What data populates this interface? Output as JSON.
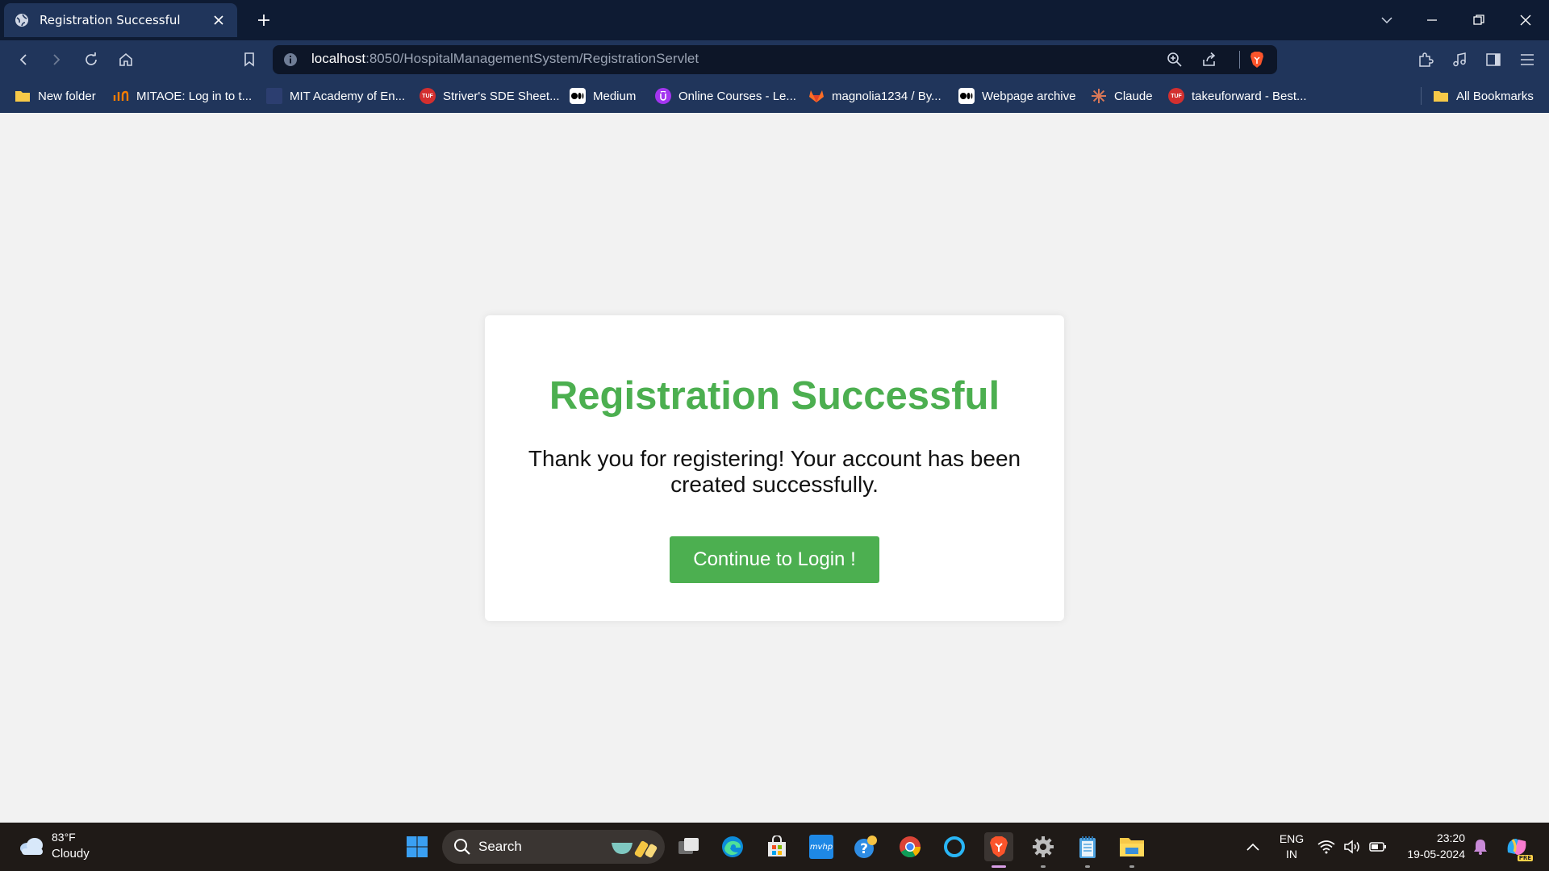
{
  "browser": {
    "tab_title": "Registration Successful",
    "url_host": "localhost",
    "url_rest": ":8050/HospitalManagementSystem/RegistrationServlet",
    "bookmarks": [
      {
        "label": "New folder",
        "icon": "folder-icon"
      },
      {
        "label": "MITAOE: Log in to t...",
        "icon": "mitaoe-icon"
      },
      {
        "label": "MIT Academy of En...",
        "icon": "mit-icon"
      },
      {
        "label": "Striver's SDE Sheet...",
        "icon": "tuf-icon"
      },
      {
        "label": "Medium",
        "icon": "medium-icon"
      },
      {
        "label": "Online Courses - Le...",
        "icon": "udemy-icon"
      },
      {
        "label": "magnolia1234 / By...",
        "icon": "gitlab-icon"
      },
      {
        "label": "Webpage archive",
        "icon": "archive-icon"
      },
      {
        "label": "Claude",
        "icon": "claude-icon"
      },
      {
        "label": "takeuforward - Best...",
        "icon": "tuf-icon"
      }
    ],
    "all_bookmarks": "All Bookmarks",
    "tuf_badge": "TUF"
  },
  "page": {
    "heading": "Registration Successful",
    "message": "Thank you for registering! Your account has been created successfully.",
    "button_label": "Continue to Login !"
  },
  "taskbar": {
    "temp": "83°F",
    "condition": "Cloudy",
    "search_label": "Search",
    "language": "ENG",
    "region": "IN",
    "time": "23:20",
    "date": "19-05-2024",
    "mvhp_label": "mvhp",
    "pre_badge": "PRE"
  },
  "colors": {
    "accent_green": "#4caf50",
    "chrome_dark": "#0e1b33",
    "chrome_mid": "#20355b"
  }
}
